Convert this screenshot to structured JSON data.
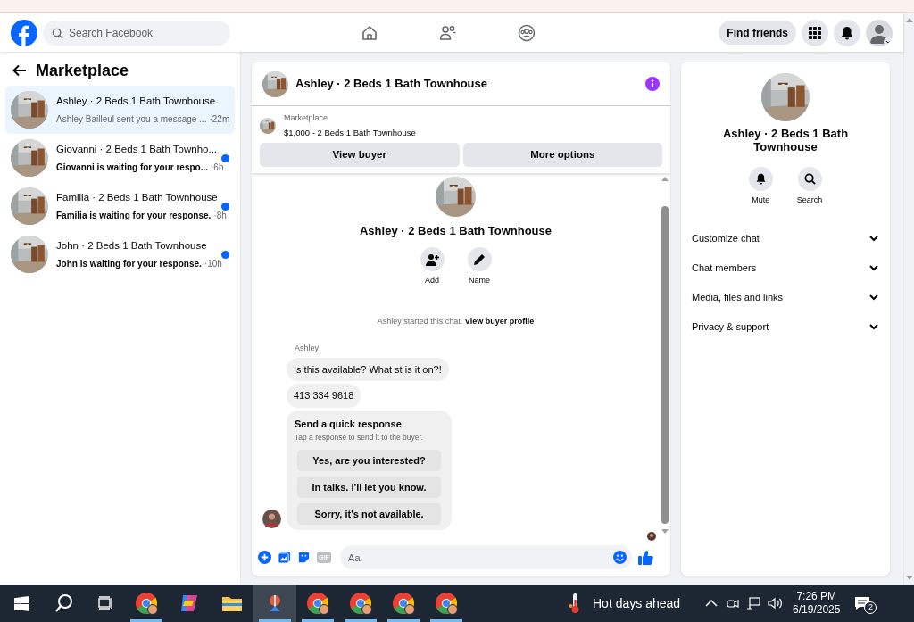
{
  "header": {
    "search_placeholder": "Search Facebook",
    "find_friends": "Find friends"
  },
  "sidebar": {
    "title": "Marketplace",
    "conversations": [
      {
        "title": "Ashley · 2 Beds 1 Bath Townhouse",
        "preview": "Ashley Bailleul sent you a message ...",
        "time": "·22m",
        "selected": true,
        "unread": false
      },
      {
        "title": "Giovanni · 2 Beds 1 Bath Townho...",
        "preview": "Giovanni is waiting for your respo...",
        "time": "·6h",
        "selected": false,
        "unread": true
      },
      {
        "title": "Familia · 2 Beds 1 Bath Townhouse",
        "preview": "Familia is waiting for your response.",
        "time": "·8h",
        "selected": false,
        "unread": true
      },
      {
        "title": "John · 2 Beds 1 Bath Townhouse",
        "preview": "John is waiting for your response.",
        "time": "·10h",
        "selected": false,
        "unread": true
      }
    ]
  },
  "chat": {
    "title": "Ashley · 2 Beds 1 Bath Townhouse",
    "listing": {
      "label": "Marketplace",
      "title": "$1,000 - 2 Beds 1 Bath Townhouse"
    },
    "buttons": [
      "View buyer",
      "More options"
    ],
    "intro": {
      "title": "Ashley · 2 Beds 1 Bath Townhouse",
      "actions": [
        {
          "kind": "add",
          "label": "Add"
        },
        {
          "kind": "edit",
          "label": "Name"
        }
      ]
    },
    "system_note": {
      "text": "Ashley started this chat.",
      "link": "View buyer profile"
    },
    "sender": "Ashley",
    "messages": [
      "Is this available? What st is it on?!",
      "413 334 9618"
    ],
    "quick_response": {
      "title": "Send a quick response",
      "subtitle": "Tap a response to send it to the buyer.",
      "options": [
        "Yes, are you interested?",
        "In talks. I'll let you know.",
        "Sorry, it's not available."
      ]
    },
    "composer": {
      "placeholder": "Aa",
      "gif": "GIF"
    }
  },
  "details": {
    "title": "Ashley · 2 Beds 1 Bath Townhouse",
    "actions": [
      {
        "kind": "bell",
        "label": "Mute"
      },
      {
        "kind": "search",
        "label": "Search"
      }
    ],
    "sections": [
      {
        "label": "Customize chat",
        "expanded": false
      },
      {
        "label": "Chat members",
        "expanded": false
      },
      {
        "label": "Media, files and links",
        "expanded": false
      },
      {
        "label": "Privacy & support",
        "expanded": false
      }
    ]
  },
  "taskbar": {
    "apps": [
      {
        "kind": "chrome",
        "running": true,
        "active": false
      },
      {
        "kind": "copilot",
        "running": false,
        "active": false
      },
      {
        "kind": "folder",
        "running": false,
        "active": false
      },
      {
        "kind": "tool",
        "running": true,
        "active": true
      },
      {
        "kind": "chrome",
        "running": true,
        "active": false
      },
      {
        "kind": "chrome",
        "running": true,
        "active": false
      },
      {
        "kind": "chrome",
        "running": true,
        "active": false
      },
      {
        "kind": "chrome",
        "running": true,
        "active": false
      }
    ],
    "weather": "Hot days ahead",
    "time": "7:26 PM",
    "date": "6/19/2025",
    "notifications": "2"
  }
}
